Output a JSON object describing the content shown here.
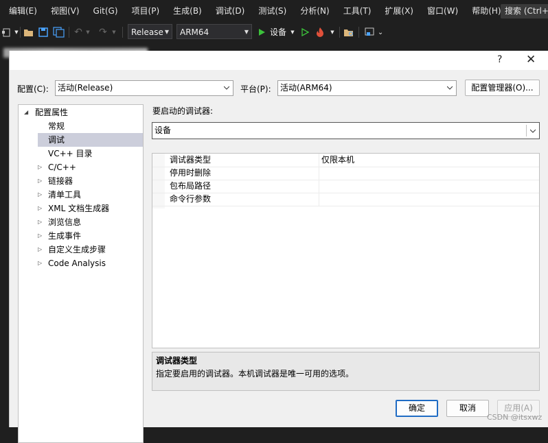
{
  "menubar": {
    "items": [
      "编辑(E)",
      "视图(V)",
      "Git(G)",
      "项目(P)",
      "生成(B)",
      "调试(D)",
      "测试(S)",
      "分析(N)",
      "工具(T)",
      "扩展(X)",
      "窗口(W)",
      "帮助(H)"
    ],
    "search": "搜索 (Ctrl+"
  },
  "toolbar": {
    "configuration": "Release",
    "platform": "ARM64",
    "run_target": "设备"
  },
  "dialog": {
    "help": "?",
    "close": "✕",
    "config_label": "配置(C):",
    "config_value": "活动(Release)",
    "platform_label": "平台(P):",
    "platform_value": "活动(ARM64)",
    "config_manager": "配置管理器(O)...",
    "debugger_label": "要启动的调试器:",
    "debugger_value": "设备",
    "tree": [
      {
        "label": "配置属性",
        "expander": "◢",
        "indent": 0,
        "selected": false
      },
      {
        "label": "常规",
        "expander": "",
        "indent": 1,
        "selected": false
      },
      {
        "label": "调试",
        "expander": "",
        "indent": 1,
        "selected": true
      },
      {
        "label": "VC++ 目录",
        "expander": "",
        "indent": 1,
        "selected": false
      },
      {
        "label": "C/C++",
        "expander": "▷",
        "indent": 1,
        "selected": false
      },
      {
        "label": "链接器",
        "expander": "▷",
        "indent": 1,
        "selected": false
      },
      {
        "label": "清单工具",
        "expander": "▷",
        "indent": 1,
        "selected": false
      },
      {
        "label": "XML 文档生成器",
        "expander": "▷",
        "indent": 1,
        "selected": false
      },
      {
        "label": "浏览信息",
        "expander": "▷",
        "indent": 1,
        "selected": false
      },
      {
        "label": "生成事件",
        "expander": "▷",
        "indent": 1,
        "selected": false
      },
      {
        "label": "自定义生成步骤",
        "expander": "▷",
        "indent": 1,
        "selected": false
      },
      {
        "label": "Code Analysis",
        "expander": "▷",
        "indent": 1,
        "selected": false
      }
    ],
    "properties": [
      {
        "name": "调试器类型",
        "value": "仅限本机"
      },
      {
        "name": "停用时删除",
        "value": ""
      },
      {
        "name": "包布局路径",
        "value": ""
      },
      {
        "name": "命令行参数",
        "value": ""
      }
    ],
    "description_title": "调试器类型",
    "description_text": "指定要启用的调试器。本机调试器是唯一可用的选项。",
    "ok": "确定",
    "cancel": "取消",
    "apply": "应用(A)"
  },
  "watermark": "CSDN @itsxwz"
}
